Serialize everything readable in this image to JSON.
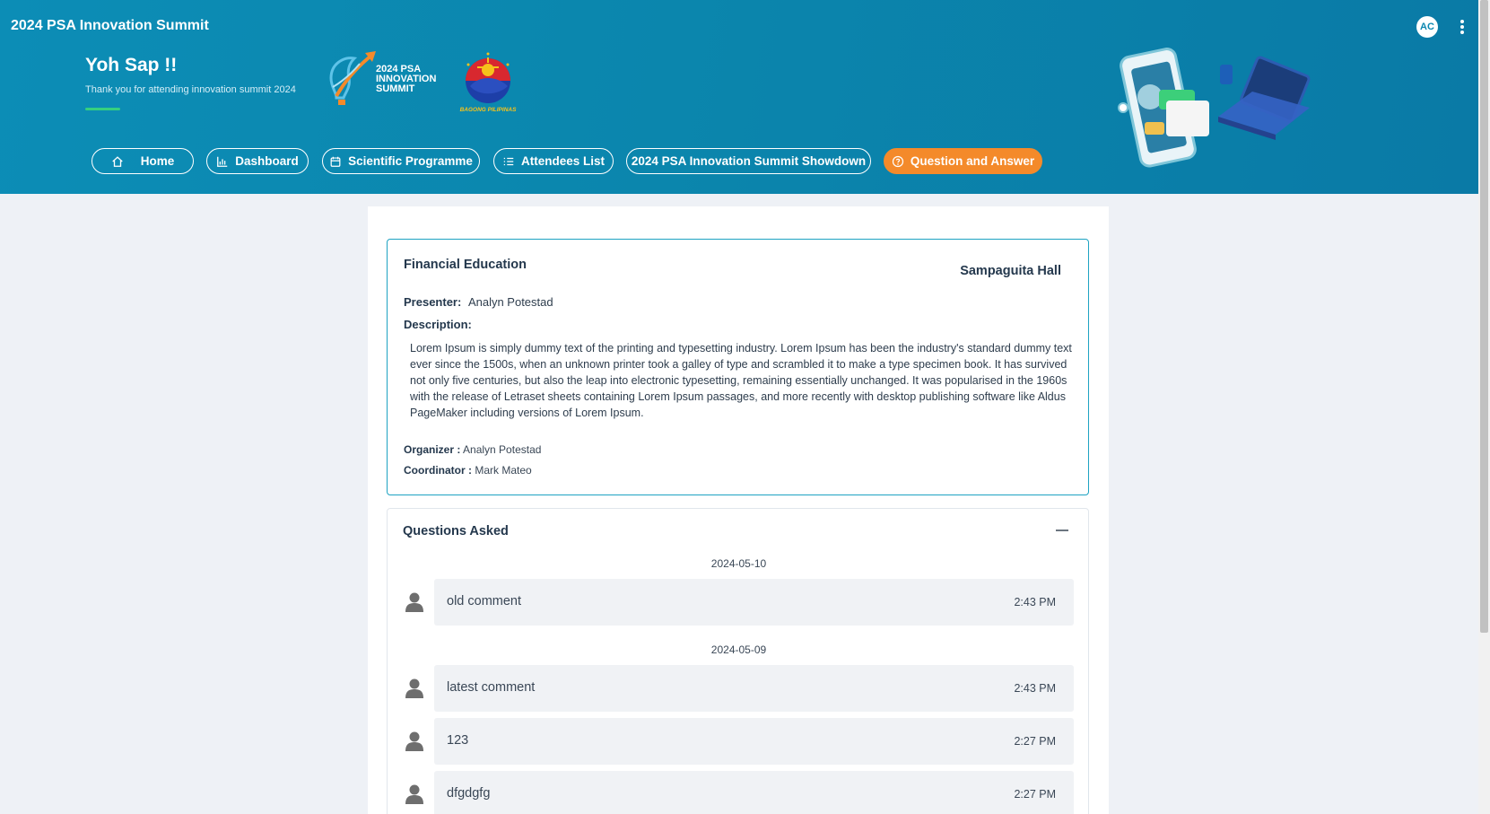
{
  "app": {
    "title": "2024 PSA Innovation Summit",
    "avatar_initials": "AC"
  },
  "hero": {
    "greeting": "Yoh Sap !!",
    "subtitle": "Thank you for attending innovation summit 2024",
    "logo_lines": [
      "2024 PSA",
      "INNOVATION",
      "SUMMIT"
    ],
    "seal_text": "BAGONG PILIPINAS"
  },
  "nav": [
    {
      "label": "Home",
      "icon": "home-icon",
      "active": false
    },
    {
      "label": "Dashboard",
      "icon": "bar-chart-icon",
      "active": false
    },
    {
      "label": "Scientific Programme",
      "icon": "calendar-icon",
      "active": false
    },
    {
      "label": "Attendees List",
      "icon": "list-icon",
      "active": false
    },
    {
      "label": "2024 PSA Innovation Summit Showdown",
      "icon": "",
      "active": false
    },
    {
      "label": "Question and Answer",
      "icon": "question-circle-icon",
      "active": true
    }
  ],
  "session": {
    "title": "Financial Education",
    "hall": "Sampaguita Hall",
    "presenter_label": "Presenter:",
    "presenter": "Analyn Potestad",
    "description_label": "Description:",
    "description": "Lorem Ipsum is simply dummy text of the printing and typesetting industry. Lorem Ipsum has been the industry's standard dummy text ever since the 1500s, when an unknown printer took a galley of type and scrambled it to make a type specimen book. It has survived not only five centuries, but also the leap into electronic typesetting, remaining essentially unchanged. It was popularised in the 1960s with the release of Letraset sheets containing Lorem Ipsum passages, and more recently with desktop publishing software like Aldus PageMaker including versions of Lorem Ipsum.",
    "organizer_label": "Organizer :",
    "organizer": "Analyn Potestad",
    "coordinator_label": "Coordinator :",
    "coordinator": "Mark Mateo"
  },
  "questions": {
    "title": "Questions Asked",
    "groups": [
      {
        "date": "2024-05-10",
        "items": [
          {
            "text": "old comment",
            "time": "2:43 PM"
          }
        ]
      },
      {
        "date": "2024-05-09",
        "items": [
          {
            "text": "latest comment",
            "time": "2:43 PM"
          },
          {
            "text": "123",
            "time": "2:27 PM"
          },
          {
            "text": "dfgdgfg",
            "time": "2:27 PM"
          }
        ]
      }
    ]
  },
  "colors": {
    "header": "#0b87b0",
    "accent": "#f48a2a",
    "underline": "#35d07f",
    "card_border": "#1ea3c2"
  }
}
